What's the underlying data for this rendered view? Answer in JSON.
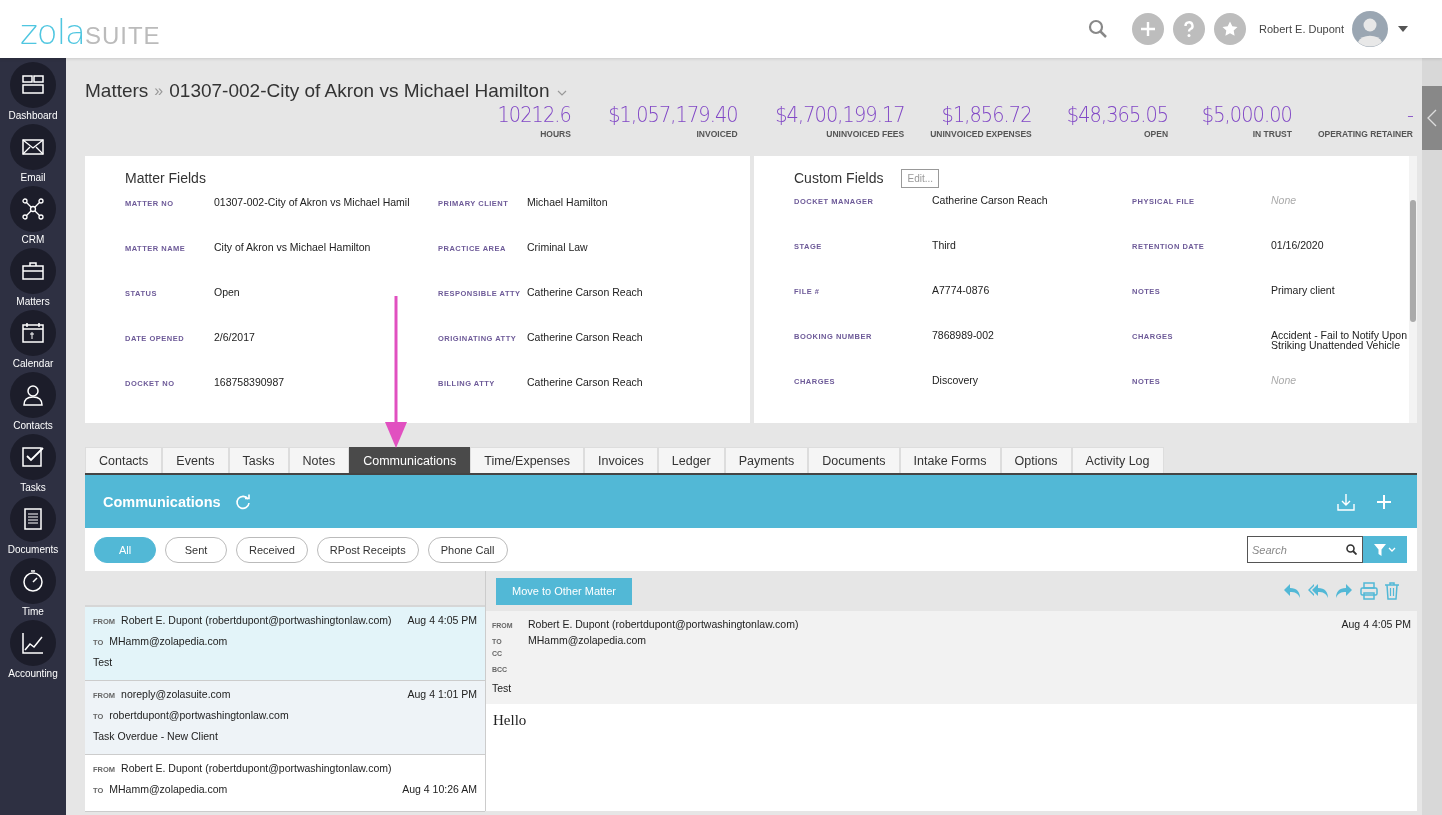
{
  "header": {
    "logo_primary": "zola",
    "logo_secondary": "SUITE",
    "user_name": "Robert E. Dupont"
  },
  "sidebar": {
    "items": [
      {
        "label": "Dashboard",
        "kind": "dashboard"
      },
      {
        "label": "Email",
        "kind": "email"
      },
      {
        "label": "CRM",
        "kind": "crm"
      },
      {
        "label": "Matters",
        "kind": "matters"
      },
      {
        "label": "Calendar",
        "kind": "calendar"
      },
      {
        "label": "Contacts",
        "kind": "contacts"
      },
      {
        "label": "Tasks",
        "kind": "tasks"
      },
      {
        "label": "Documents",
        "kind": "documents"
      },
      {
        "label": "Time",
        "kind": "time"
      },
      {
        "label": "Accounting",
        "kind": "accounting"
      }
    ]
  },
  "breadcrumb": {
    "root": "Matters",
    "separator": "»",
    "current": "01307-002-City of Akron vs Michael Hamilton"
  },
  "stats": [
    {
      "value": "10212.6",
      "label": "HOURS"
    },
    {
      "value": "$1,057,179.40",
      "label": "INVOICED"
    },
    {
      "value": "$4,700,199.17",
      "label": "UNINVOICED FEES"
    },
    {
      "value": "$1,856.72",
      "label": "UNINVOICED EXPENSES"
    },
    {
      "value": "$48,365.05",
      "label": "OPEN"
    },
    {
      "value": "$5,000.00",
      "label": "IN TRUST"
    },
    {
      "value": "-",
      "label": "OPERATING RETAINER"
    }
  ],
  "matter_fields": {
    "title": "Matter Fields",
    "fields": [
      {
        "label": "MATTER NO",
        "value": "01307-002-City of Akron vs Michael Hamil"
      },
      {
        "label": "PRIMARY CLIENT",
        "value": "Michael Hamilton"
      },
      {
        "label": "MATTER NAME",
        "value": "City of Akron vs Michael Hamilton"
      },
      {
        "label": "PRACTICE AREA",
        "value": "Criminal Law"
      },
      {
        "label": "STATUS",
        "value": "Open"
      },
      {
        "label": "RESPONSIBLE ATTY",
        "value": "Catherine Carson Reach"
      },
      {
        "label": "DATE OPENED",
        "value": "2/6/2017"
      },
      {
        "label": "ORIGINATING ATTY",
        "value": "Catherine Carson Reach"
      },
      {
        "label": "DOCKET NO",
        "value": "168758390987"
      },
      {
        "label": "BILLING ATTY",
        "value": "Catherine Carson Reach"
      }
    ]
  },
  "custom_fields": {
    "title": "Custom Fields",
    "edit_button": "Edit...",
    "fields": [
      {
        "label": "DOCKET MANAGER",
        "value": "Catherine Carson Reach",
        "empty": false
      },
      {
        "label": "PHYSICAL FILE",
        "value": "None",
        "empty": true
      },
      {
        "label": "STAGE",
        "value": "Third",
        "empty": false
      },
      {
        "label": "RETENTION DATE",
        "value": "01/16/2020",
        "empty": false
      },
      {
        "label": "FILE #",
        "value": "A7774-0876",
        "empty": false
      },
      {
        "label": "NOTES",
        "value": "Primary client",
        "empty": false
      },
      {
        "label": "BOOKING NUMBER",
        "value": "7868989-002",
        "empty": false
      },
      {
        "label": "CHARGES",
        "value": "Accident - Fail to Notify Upon Striking Unattended Vehicle",
        "empty": false
      },
      {
        "label": "CHARGES",
        "value": "Discovery",
        "empty": false
      },
      {
        "label": "NOTES",
        "value": "None",
        "empty": true
      }
    ]
  },
  "tabs": [
    {
      "label": "Contacts",
      "selected": false
    },
    {
      "label": "Events",
      "selected": false
    },
    {
      "label": "Tasks",
      "selected": false
    },
    {
      "label": "Notes",
      "selected": false
    },
    {
      "label": "Communications",
      "selected": true
    },
    {
      "label": "Time/Expenses",
      "selected": false
    },
    {
      "label": "Invoices",
      "selected": false
    },
    {
      "label": "Ledger",
      "selected": false
    },
    {
      "label": "Payments",
      "selected": false
    },
    {
      "label": "Documents",
      "selected": false
    },
    {
      "label": "Intake Forms",
      "selected": false
    },
    {
      "label": "Options",
      "selected": false
    },
    {
      "label": "Activity Log",
      "selected": false
    }
  ],
  "communications": {
    "title": "Communications",
    "filters": [
      {
        "label": "All",
        "selected": true
      },
      {
        "label": "Sent",
        "selected": false
      },
      {
        "label": "Received",
        "selected": false
      },
      {
        "label": "RPost Receipts",
        "selected": false
      },
      {
        "label": "Phone Call",
        "selected": false
      }
    ],
    "search": {
      "placeholder": "Search"
    },
    "messages": [
      {
        "from_label": "FROM",
        "from": "Robert E. Dupont (robertdupont@portwashingtonlaw.com)",
        "to_label": "TO",
        "to": "MHamm@zolapedia.com",
        "subject": "Test",
        "time": "Aug 4 4:05 PM",
        "time_on_to_line": false,
        "selected": true,
        "unread": false
      },
      {
        "from_label": "FROM",
        "from": "noreply@zolasuite.com",
        "to_label": "TO",
        "to": "robertdupont@portwashingtonlaw.com",
        "subject": "Task Overdue - New Client",
        "time": "Aug 4 1:01 PM",
        "time_on_to_line": false,
        "selected": false,
        "unread": true
      },
      {
        "from_label": "FROM",
        "from": "Robert E. Dupont (robertdupont@portwashingtonlaw.com)",
        "to_label": "TO",
        "to": "MHamm@zolapedia.com",
        "time": "Aug 4 10:26 AM",
        "time_on_to_line": true,
        "selected": false,
        "unread": false
      }
    ],
    "detail": {
      "move_button": "Move to Other Matter",
      "from_label": "FROM",
      "from": "Robert E. Dupont (robertdupont@portwashingtonlaw.com)",
      "time": "Aug 4 4:05 PM",
      "to_label": "TO",
      "to": "MHamm@zolapedia.com",
      "cc_label": "CC",
      "bcc_label": "BCC",
      "subject": "Test",
      "body": "Hello"
    }
  }
}
